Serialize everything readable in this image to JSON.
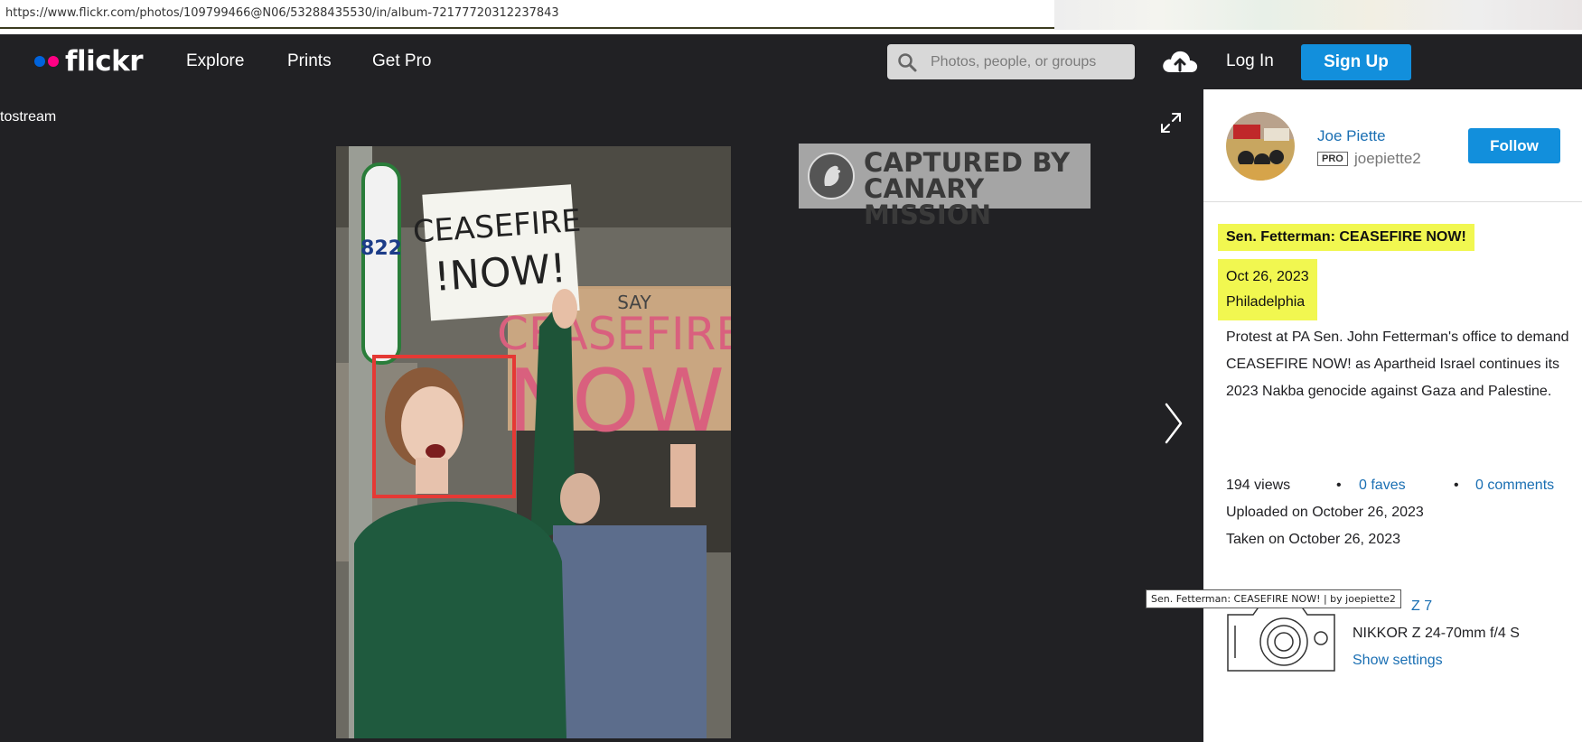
{
  "browser": {
    "url": "https://www.flickr.com/photos/109799466@N06/53288435530/in/album-72177720312237843"
  },
  "nav": {
    "logo_text": "flickr",
    "links": [
      "Explore",
      "Prints",
      "Get Pro"
    ],
    "search_placeholder": "Photos, people, or groups",
    "login": "Log In",
    "signup": "Sign Up"
  },
  "stage": {
    "back_label": "tostream",
    "watermark_line1": "CAPTURED BY",
    "watermark_line2": "CANARY MISSION",
    "photo_signs": {
      "sign1_line1": "CEASEFIRE",
      "sign1_line2": "!NOW!",
      "sign2_line1": "SAY",
      "sign2_line2": "CEASEFIRE",
      "sign2_line3": "NOW",
      "street_sign": "822"
    }
  },
  "owner": {
    "name": "Joe Piette",
    "badge": "PRO",
    "username": "joepiette2",
    "follow": "Follow"
  },
  "photo": {
    "title": "Sen. Fetterman: CEASEFIRE NOW!",
    "date": "Oct 26, 2023",
    "location": "Philadelphia",
    "description": "Protest at PA Sen. John Fetterman's office to demand CEASEFIRE NOW! as Apartheid Israel continues its 2023 Nakba genocide against Gaza and Palestine.",
    "views": "194 views",
    "faves": "0 faves",
    "comments": "0 comments",
    "uploaded": "Uploaded on October 26, 2023",
    "taken": "Taken on October 26, 2023"
  },
  "camera": {
    "model_partial": "Z 7",
    "lens": "NIKKOR Z 24-70mm f/4 S",
    "settings_link": "Show settings"
  },
  "tooltip": "Sen. Fetterman: CEASEFIRE NOW! | by joepiette2",
  "colors": {
    "accent": "#128fdc",
    "link": "#1a6fb3",
    "highlight": "#f1f750",
    "stage_bg": "#212124",
    "annotation": "#e53935"
  }
}
